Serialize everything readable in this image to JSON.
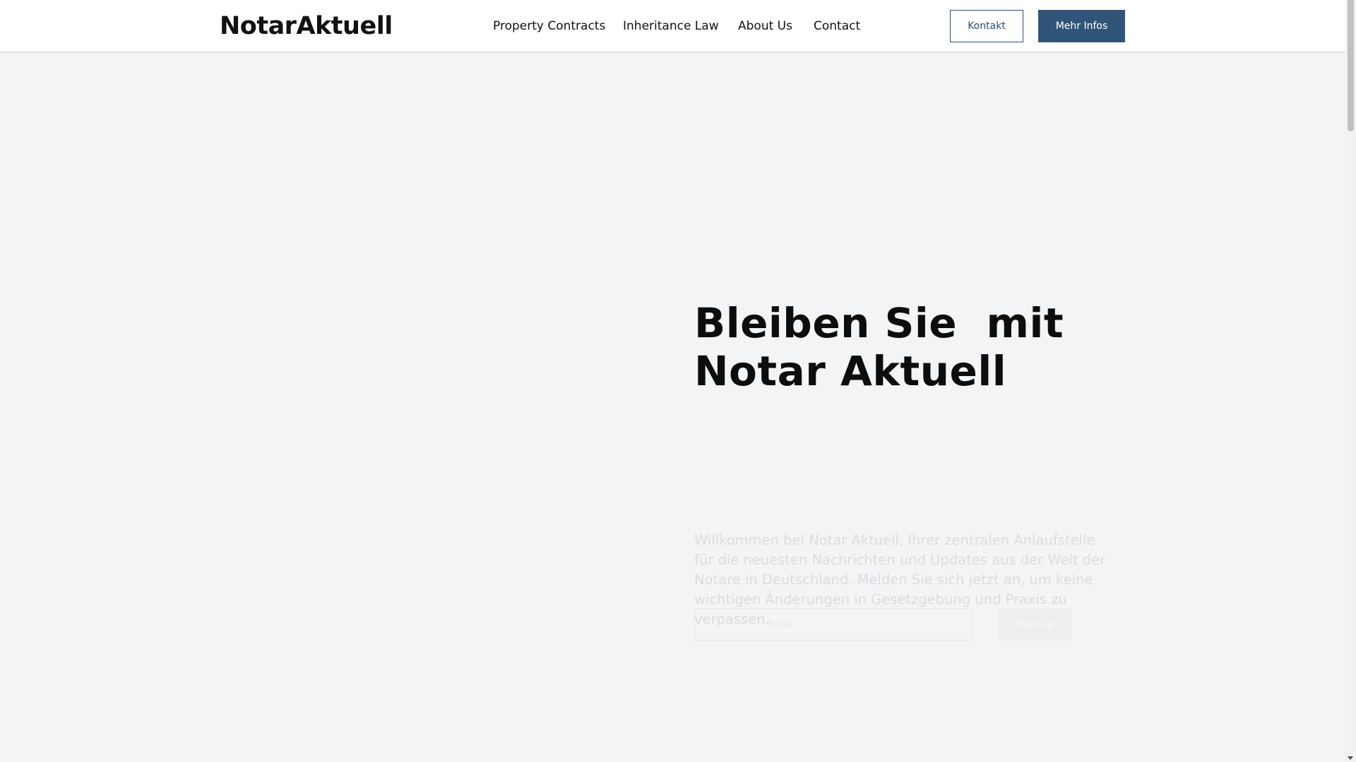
{
  "header": {
    "logo": "NotarAktuell",
    "nav": [
      {
        "label": "Property Contracts"
      },
      {
        "label": "Inheritance Law"
      },
      {
        "label": "About Us"
      },
      {
        "label": "Contact"
      }
    ],
    "kontakt_label": "Kontakt",
    "mehr_infos_label": "Mehr Infos"
  },
  "hero": {
    "title_line1": "Bleiben Sie  mit",
    "title_line2": "Notar Aktuell",
    "text": "Willkommen bei Notar Aktuell, Ihrer zentralen Anlaufstelle für die neuesten Nachrichten und Updates aus der Welt der Notare in Deutschland. Melden Sie sich jetzt an, um keine wichtigen Änderungen in Gesetzgebung und Praxis zu verpassen.",
    "email_placeholder": "Email",
    "signup_label": "Sign up"
  },
  "colors": {
    "accent": "#315578",
    "background": "#f3f4f5"
  }
}
